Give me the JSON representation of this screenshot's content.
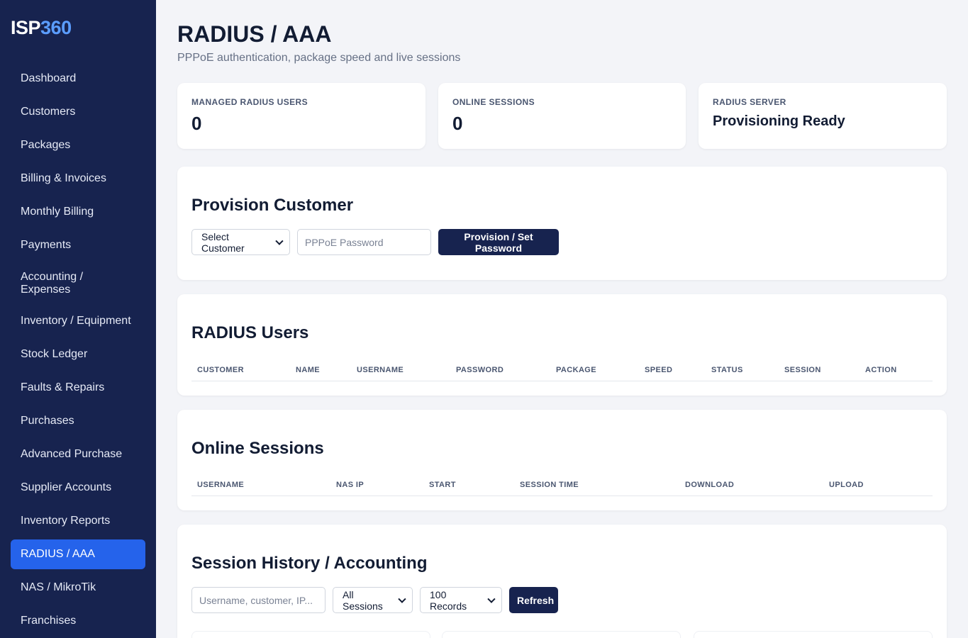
{
  "sidebar": {
    "logo_main": "ISP",
    "logo_accent": "360",
    "items": [
      {
        "label": "Dashboard"
      },
      {
        "label": "Customers"
      },
      {
        "label": "Packages"
      },
      {
        "label": "Billing & Invoices"
      },
      {
        "label": "Monthly Billing"
      },
      {
        "label": "Payments"
      },
      {
        "label": "Accounting / Expenses"
      },
      {
        "label": "Inventory / Equipment"
      },
      {
        "label": "Stock Ledger"
      },
      {
        "label": "Faults & Repairs"
      },
      {
        "label": "Purchases"
      },
      {
        "label": "Advanced Purchase"
      },
      {
        "label": "Supplier Accounts"
      },
      {
        "label": "Inventory Reports"
      },
      {
        "label": "RADIUS / AAA"
      },
      {
        "label": "NAS / MikroTik"
      },
      {
        "label": "Franchises"
      }
    ],
    "active": "RADIUS / AAA"
  },
  "header": {
    "title": "RADIUS / AAA",
    "subtitle": "PPPoE authentication, package speed and live sessions"
  },
  "stats": [
    {
      "label": "MANAGED RADIUS USERS",
      "value": "0"
    },
    {
      "label": "ONLINE SESSIONS",
      "value": "0"
    },
    {
      "label": "RADIUS SERVER",
      "value": "Provisioning Ready"
    }
  ],
  "provision": {
    "title": "Provision Customer",
    "customer_select": "Select Customer",
    "password_placeholder": "PPPoE Password",
    "button": "Provision / Set Password"
  },
  "radius_users": {
    "title": "RADIUS Users",
    "columns": [
      "CUSTOMER",
      "NAME",
      "USERNAME",
      "PASSWORD",
      "PACKAGE",
      "SPEED",
      "STATUS",
      "SESSION",
      "ACTION"
    ]
  },
  "online_sessions": {
    "title": "Online Sessions",
    "columns": [
      "USERNAME",
      "NAS IP",
      "START",
      "SESSION TIME",
      "DOWNLOAD",
      "UPLOAD"
    ]
  },
  "history": {
    "title": "Session History / Accounting",
    "search_placeholder": "Username, customer, IP...",
    "filter_select": "All Sessions",
    "records_select": "100 Records",
    "refresh_button": "Refresh"
  },
  "colors": {
    "sidebar_bg": "#17234f",
    "active_item": "#2563eb",
    "logo_accent": "#5b9dff",
    "primary_button": "#17234f"
  }
}
